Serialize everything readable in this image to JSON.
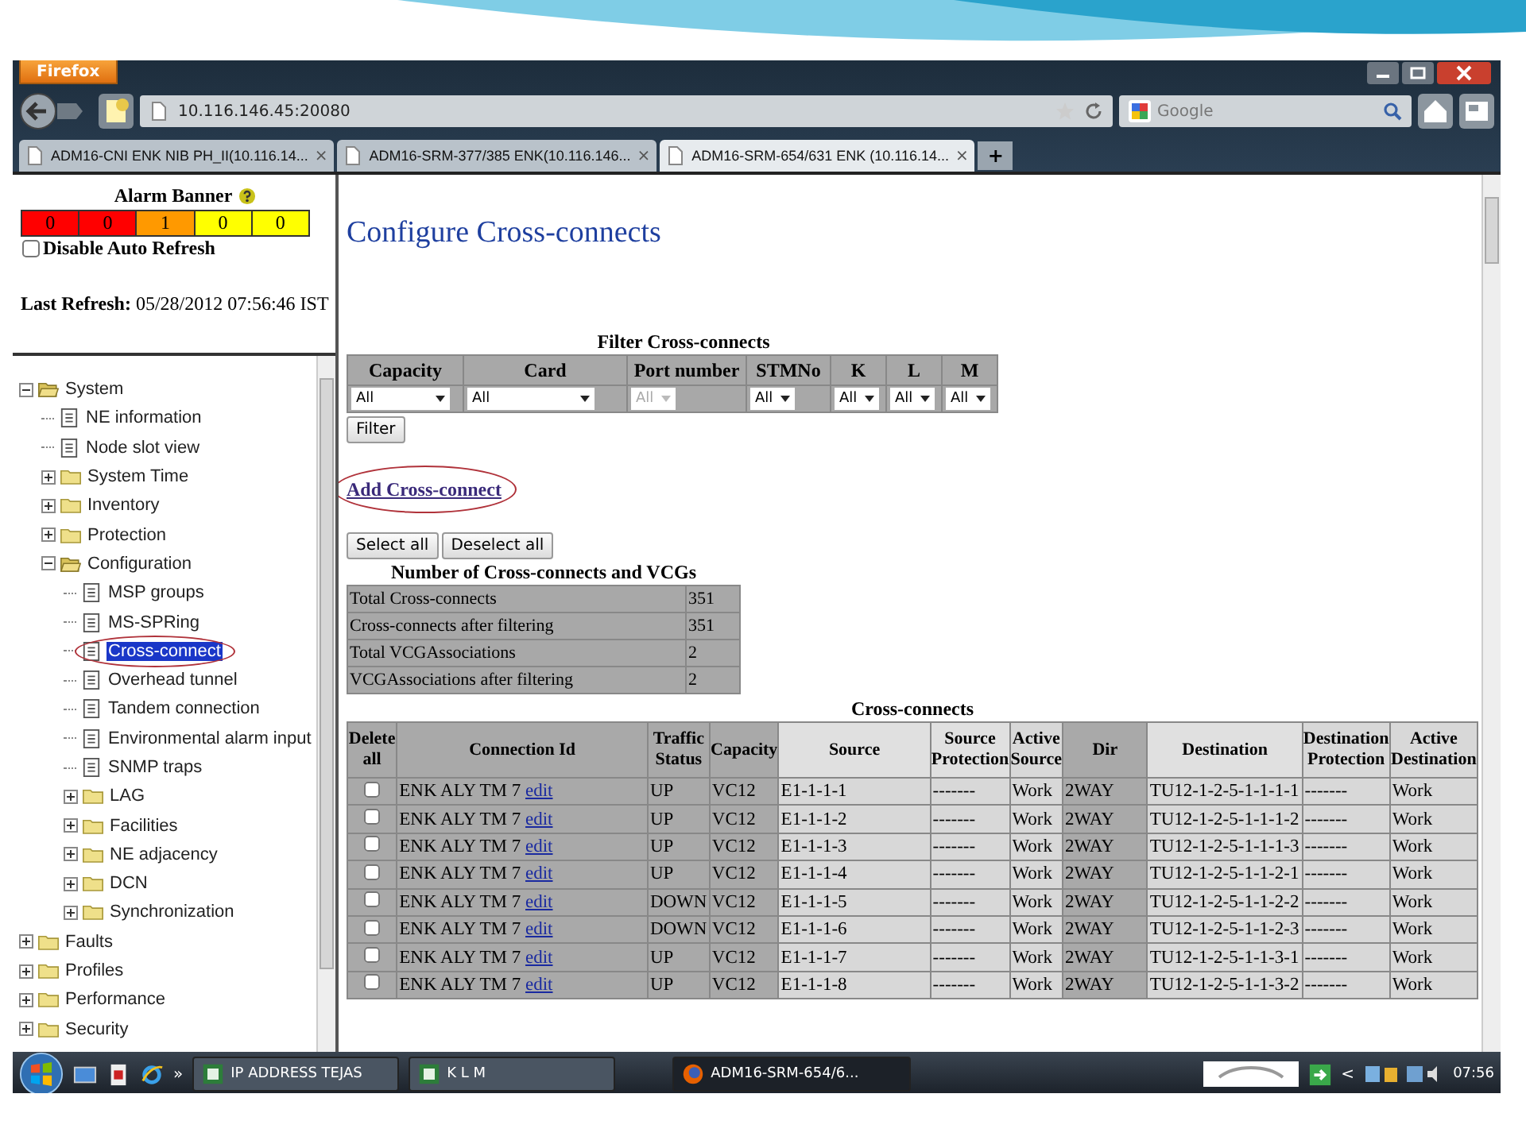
{
  "browser": {
    "menu_button": "Firefox",
    "address": "10.116.146.45:20080",
    "search": {
      "placeholder": "Google"
    },
    "tabs": [
      {
        "label": "ADM16-CNI ENK NIB PH_II(10.116.14...",
        "close": "×",
        "selected": false
      },
      {
        "label": "ADM16-SRM-377/385 ENK(10.116.146...",
        "close": "×",
        "selected": false
      },
      {
        "label": "ADM16-SRM-654/631 ENK (10.116.14...",
        "close": "×",
        "selected": true
      }
    ],
    "new_tab": "+"
  },
  "sidebar": {
    "alarm_banner": {
      "title": "Alarm Banner",
      "counts": [
        {
          "value": "0",
          "color": "#ff0000"
        },
        {
          "value": "0",
          "color": "#ff0000"
        },
        {
          "value": "1",
          "color": "#ff9900"
        },
        {
          "value": "0",
          "color": "#ffff00"
        },
        {
          "value": "0",
          "color": "#ffff00"
        }
      ]
    },
    "auto_refresh": {
      "label": "Disable Auto Refresh",
      "checked": false
    },
    "last_refresh": {
      "label": "Last Refresh:",
      "value": "05/28/2012 07:56:46 IST"
    },
    "tree": [
      {
        "label": "System",
        "kind": "folder",
        "expanded": true,
        "selected": false,
        "circled": false,
        "children": [
          {
            "label": "NE information",
            "kind": "page",
            "selected": false,
            "circled": false
          },
          {
            "label": "Node slot view",
            "kind": "page",
            "selected": false,
            "circled": false
          },
          {
            "label": "System Time",
            "kind": "folder",
            "expanded": false,
            "selected": false,
            "circled": false
          },
          {
            "label": "Inventory",
            "kind": "folder",
            "expanded": false,
            "selected": false,
            "circled": false
          },
          {
            "label": "Protection",
            "kind": "folder",
            "expanded": false,
            "selected": false,
            "circled": false
          },
          {
            "label": "Configuration",
            "kind": "folder",
            "expanded": true,
            "selected": false,
            "circled": false,
            "children": [
              {
                "label": "MSP groups",
                "kind": "page",
                "selected": false,
                "circled": false
              },
              {
                "label": "MS-SPRing",
                "kind": "page",
                "selected": false,
                "circled": false
              },
              {
                "label": "Cross-connect",
                "kind": "page",
                "selected": true,
                "circled": true
              },
              {
                "label": "Overhead tunnel",
                "kind": "page",
                "selected": false,
                "circled": false
              },
              {
                "label": "Tandem connection",
                "kind": "page",
                "selected": false,
                "circled": false
              },
              {
                "label": "Environmental alarm input",
                "kind": "page",
                "selected": false,
                "circled": false
              },
              {
                "label": "SNMP traps",
                "kind": "page",
                "selected": false,
                "circled": false
              },
              {
                "label": "LAG",
                "kind": "folder",
                "expanded": false,
                "selected": false,
                "circled": false
              },
              {
                "label": "Facilities",
                "kind": "folder",
                "expanded": false,
                "selected": false,
                "circled": false
              },
              {
                "label": "NE adjacency",
                "kind": "folder",
                "expanded": false,
                "selected": false,
                "circled": false
              },
              {
                "label": "DCN",
                "kind": "folder",
                "expanded": false,
                "selected": false,
                "circled": false
              },
              {
                "label": "Synchronization",
                "kind": "folder",
                "expanded": false,
                "selected": false,
                "circled": false
              }
            ]
          }
        ]
      },
      {
        "label": "Faults",
        "kind": "folder",
        "expanded": false,
        "selected": false,
        "circled": false
      },
      {
        "label": "Profiles",
        "kind": "folder",
        "expanded": false,
        "selected": false,
        "circled": false
      },
      {
        "label": "Performance",
        "kind": "folder",
        "expanded": false,
        "selected": false,
        "circled": false
      },
      {
        "label": "Security",
        "kind": "folder",
        "expanded": false,
        "selected": false,
        "circled": false
      }
    ]
  },
  "main": {
    "title": "Configure Cross-connects",
    "filter": {
      "caption": "Filter Cross-connects",
      "button": "Filter",
      "columns": [
        {
          "label": "Capacity",
          "value": "All",
          "disabled": false
        },
        {
          "label": "Card",
          "value": "All",
          "disabled": false
        },
        {
          "label": "Port number",
          "value": "All",
          "disabled": true
        },
        {
          "label": "STMNo",
          "value": "All",
          "disabled": false
        },
        {
          "label": "K",
          "value": "All",
          "disabled": false
        },
        {
          "label": "L",
          "value": "All",
          "disabled": false
        },
        {
          "label": "M",
          "value": "All",
          "disabled": false
        }
      ]
    },
    "add_link": {
      "label": "Add Cross-connect",
      "circled": true
    },
    "select_buttons": [
      "Select all",
      "Deselect all"
    ],
    "counts": {
      "caption": "Number of Cross-connects and VCGs",
      "rows": [
        {
          "label": "Total Cross-connects",
          "value": "351"
        },
        {
          "label": "Cross-connects after filtering",
          "value": "351"
        },
        {
          "label": "Total VCGAssociations",
          "value": "2"
        },
        {
          "label": "VCGAssociations after filtering",
          "value": "2"
        }
      ]
    },
    "cross_connects": {
      "caption": "Cross-connects",
      "columns": [
        "Delete all",
        "Connection Id",
        "Traffic Status",
        "Capacity",
        "Source",
        "Source Protection",
        "Active Source",
        "Dir",
        "Destination",
        "Destination Protection",
        "Active Destination"
      ],
      "rows": [
        {
          "cells": [
            {
              "kind": "checkbox",
              "checked": false
            },
            {
              "kind": "link",
              "text": "ENK ALY TM 7",
              "link": "edit"
            },
            "UP",
            "VC12",
            "E1-1-1-1",
            "-------",
            "Work",
            "2WAY",
            "TU12-1-2-5-1-1-1-1",
            "-------",
            "Work"
          ]
        },
        {
          "cells": [
            {
              "kind": "checkbox",
              "checked": false
            },
            {
              "kind": "link",
              "text": "ENK ALY TM 7",
              "link": "edit"
            },
            "UP",
            "VC12",
            "E1-1-1-2",
            "-------",
            "Work",
            "2WAY",
            "TU12-1-2-5-1-1-1-2",
            "-------",
            "Work"
          ]
        },
        {
          "cells": [
            {
              "kind": "checkbox",
              "checked": false
            },
            {
              "kind": "link",
              "text": "ENK ALY TM 7",
              "link": "edit"
            },
            "UP",
            "VC12",
            "E1-1-1-3",
            "-------",
            "Work",
            "2WAY",
            "TU12-1-2-5-1-1-1-3",
            "-------",
            "Work"
          ]
        },
        {
          "cells": [
            {
              "kind": "checkbox",
              "checked": false
            },
            {
              "kind": "link",
              "text": "ENK ALY TM 7",
              "link": "edit"
            },
            "UP",
            "VC12",
            "E1-1-1-4",
            "-------",
            "Work",
            "2WAY",
            "TU12-1-2-5-1-1-2-1",
            "-------",
            "Work"
          ]
        },
        {
          "cells": [
            {
              "kind": "checkbox",
              "checked": false
            },
            {
              "kind": "link",
              "text": "ENK ALY TM 7",
              "link": "edit"
            },
            "DOWN",
            "VC12",
            "E1-1-1-5",
            "-------",
            "Work",
            "2WAY",
            "TU12-1-2-5-1-1-2-2",
            "-------",
            "Work"
          ]
        },
        {
          "cells": [
            {
              "kind": "checkbox",
              "checked": false
            },
            {
              "kind": "link",
              "text": "ENK ALY TM 7",
              "link": "edit"
            },
            "DOWN",
            "VC12",
            "E1-1-1-6",
            "-------",
            "Work",
            "2WAY",
            "TU12-1-2-5-1-1-2-3",
            "-------",
            "Work"
          ]
        },
        {
          "cells": [
            {
              "kind": "checkbox",
              "checked": false
            },
            {
              "kind": "link",
              "text": "ENK ALY TM 7",
              "link": "edit"
            },
            "UP",
            "VC12",
            "E1-1-1-7",
            "-------",
            "Work",
            "2WAY",
            "TU12-1-2-5-1-1-3-1",
            "-------",
            "Work"
          ]
        },
        {
          "cells": [
            {
              "kind": "checkbox",
              "checked": false
            },
            {
              "kind": "link",
              "text": "ENK ALY TM 7",
              "link": "edit"
            },
            "UP",
            "VC12",
            "E1-1-1-8",
            "-------",
            "Work",
            "2WAY",
            "TU12-1-2-5-1-1-3-2",
            "-------",
            "Work"
          ]
        }
      ]
    }
  },
  "taskbar": {
    "overflow": "»",
    "items": [
      {
        "label": "IP ADDRESS TEJAS",
        "kind": "sheet",
        "selected": false
      },
      {
        "label": "K L M",
        "kind": "sheet",
        "selected": false
      },
      {
        "label": "ADM16-SRM-654/6...",
        "kind": "browser",
        "selected": true
      }
    ],
    "tray_toggle": "<",
    "clock": "07:56"
  }
}
